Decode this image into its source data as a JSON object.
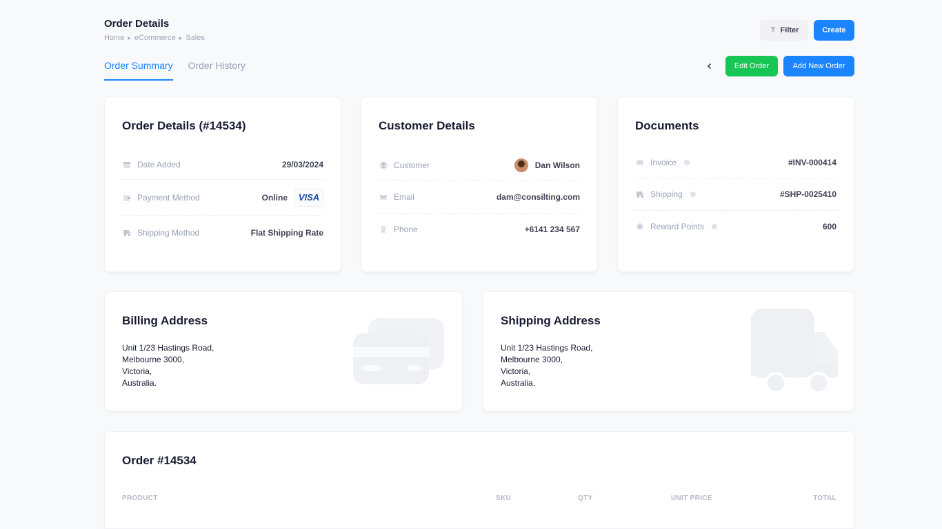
{
  "header": {
    "title": "Order Details",
    "breadcrumb": [
      "Home",
      "eCommerce",
      "Sales"
    ],
    "filter_label": "Filter",
    "create_label": "Create"
  },
  "tabs": [
    {
      "label": "Order Summary",
      "active": true
    },
    {
      "label": "Order History",
      "active": false
    }
  ],
  "actions": {
    "edit_label": "Edit Order",
    "new_label": "Add New Order"
  },
  "order_card": {
    "title": "Order Details (#14534)",
    "rows": [
      {
        "label": "Date Added",
        "value": "29/03/2024",
        "icon": "calendar-icon"
      },
      {
        "label": "Payment Method",
        "value": "Online",
        "badge": "VISA",
        "icon": "wallet-icon"
      },
      {
        "label": "Shipping Method",
        "value": "Flat Shipping Rate",
        "icon": "truck-icon"
      }
    ]
  },
  "customer_card": {
    "title": "Customer Details",
    "rows": [
      {
        "label": "Customer",
        "value": "Dan Wilson",
        "icon": "user-icon"
      },
      {
        "label": "Email",
        "value": "dam@consilting.com",
        "icon": "envelope-icon"
      },
      {
        "label": "Phone",
        "value": "+6141 234 567",
        "icon": "phone-icon"
      }
    ]
  },
  "documents_card": {
    "title": "Documents",
    "rows": [
      {
        "label": "Invoice",
        "value": "#INV-000414",
        "icon": "invoice-icon"
      },
      {
        "label": "Shipping",
        "value": "#SHP-0025410",
        "icon": "truck-icon"
      },
      {
        "label": "Reward Points",
        "value": "600",
        "icon": "award-icon"
      }
    ]
  },
  "billing": {
    "title": "Billing Address",
    "lines": [
      "Unit 1/23 Hastings Road,",
      "Melbourne 3000,",
      "Victoria,",
      "Australia."
    ]
  },
  "shipping": {
    "title": "Shipping Address",
    "lines": [
      "Unit 1/23 Hastings Road,",
      "Melbourne 3000,",
      "Victoria,",
      "Australia."
    ]
  },
  "order_table": {
    "title": "Order #14534",
    "columns": [
      "PRODUCT",
      "SKU",
      "QTY",
      "UNIT PRICE",
      "TOTAL"
    ]
  },
  "colors": {
    "primary": "#1b84ff",
    "success": "#17c653",
    "muted": "#99a1b7"
  }
}
